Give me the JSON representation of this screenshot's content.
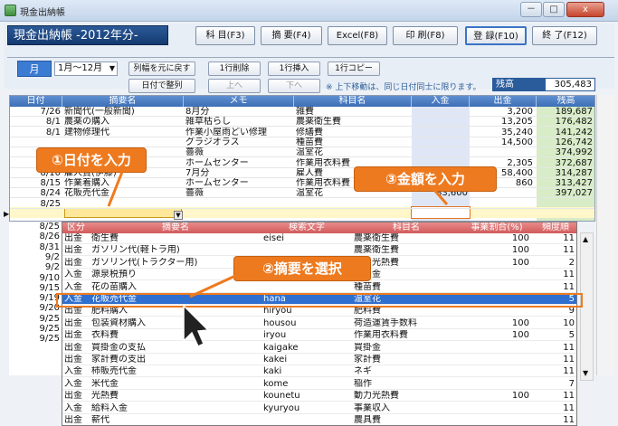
{
  "window": {
    "title": "現金出納帳",
    "min_label": "－",
    "max_label": "□",
    "close_label": "x"
  },
  "app_title": "現金出納帳 -2012年分-",
  "toolbar": [
    {
      "label": "科 目(F3)"
    },
    {
      "label": "摘 要(F4)"
    },
    {
      "label": "Excel(F8)"
    },
    {
      "label": "印 刷(F8)"
    },
    {
      "label": "登 録(F10)"
    },
    {
      "label": "終 了(F12)"
    }
  ],
  "controls": {
    "month_button": "月",
    "month_range": "1月〜12月",
    "reset_width": "列幅を元に戻す",
    "delete_row": "1行削除",
    "insert_row": "1行挿入",
    "copy_row": "1行コピー",
    "sort_date": "日付で整列",
    "up": "上へ",
    "down": "下へ",
    "note": "※ 上下移動は、同じ日付同士に限ります。",
    "balance_label": "残高",
    "balance_value": "305,483"
  },
  "ledger": {
    "headers": [
      "日付",
      "摘要名",
      "メモ",
      "科目名",
      "入金",
      "出金",
      "残高"
    ],
    "rows": [
      {
        "date": "7/26",
        "desc": "新聞代(一般新聞)",
        "memo": "8月分",
        "account": "雑費",
        "in": "",
        "out": "3,200",
        "bal": "189,687"
      },
      {
        "date": "8/1",
        "desc": "農薬の購入",
        "memo": "雑草枯らし",
        "account": "農薬衛生費",
        "in": "",
        "out": "13,205",
        "bal": "176,482"
      },
      {
        "date": "8/1",
        "desc": "建物修理代",
        "memo": "作業小屋雨どい修理",
        "account": "修繕費",
        "in": "",
        "out": "35,240",
        "bal": "141,242"
      },
      {
        "date": "",
        "desc": "",
        "memo": "グラジオラス",
        "account": "種苗費",
        "in": "",
        "out": "14,500",
        "bal": "126,742"
      },
      {
        "date": "",
        "desc": "",
        "memo": "薔薇",
        "account": "温室花",
        "in": "",
        "out": "",
        "bal": "374,992"
      },
      {
        "date": "8/6",
        "desc": "作業着購入",
        "memo": "ホームセンター",
        "account": "作業用衣料費",
        "in": "",
        "out": "2,305",
        "bal": "372,687"
      },
      {
        "date": "8/10",
        "desc": "雇人費(伊藤)",
        "memo": "7月分",
        "account": "雇人費",
        "in": "",
        "out": "58,400",
        "bal": "314,287"
      },
      {
        "date": "8/15",
        "desc": "作業着購入",
        "memo": "ホームセンター",
        "account": "作業用衣料費",
        "in": "",
        "out": "860",
        "bal": "313,427"
      },
      {
        "date": "8/24",
        "desc": "花販売代金",
        "memo": "薔薇",
        "account": "温室花",
        "in": "83,600",
        "out": "",
        "bal": "397,027"
      },
      {
        "date": "8/25",
        "desc": "",
        "memo": "",
        "account": "",
        "in": "",
        "out": "",
        "bal": ""
      }
    ]
  },
  "side_dates": [
    "8/25",
    "8/26",
    "8/31",
    "9/2",
    "9/2",
    "9/10",
    "9/15",
    "9/19",
    "9/20",
    "9/25",
    "9/25",
    "9/25"
  ],
  "callouts": {
    "date": "①日付を入力",
    "amount": "③金額を入力",
    "summary": "②摘要を選択"
  },
  "dropdown": {
    "headers": [
      "区分",
      "摘要名",
      "検索文字",
      "科目名",
      "事業割合(%)",
      "頻度順"
    ],
    "rows": [
      {
        "kind": "出金",
        "name": "衛生費",
        "search": "eisei",
        "account": "農薬衛生費",
        "ratio": "100",
        "freq": "11"
      },
      {
        "kind": "出金",
        "name": "ガソリン代(軽トラ用)",
        "search": "",
        "account": "農薬衛生費",
        "ratio": "100",
        "freq": "11"
      },
      {
        "kind": "出金",
        "name": "ガソリン代(トラクター用)",
        "search": "",
        "account": "動力光熱費",
        "ratio": "100",
        "freq": "2"
      },
      {
        "kind": "入金",
        "name": "源泉税預り",
        "search": "",
        "account": "預り金",
        "ratio": "",
        "freq": "11"
      },
      {
        "kind": "入金",
        "name": "花の苗購入",
        "search": "",
        "account": "種苗費",
        "ratio": "",
        "freq": "11"
      },
      {
        "kind": "入金",
        "name": "花販売代金",
        "search": "hana",
        "account": "温室花",
        "ratio": "",
        "freq": "5"
      },
      {
        "kind": "出金",
        "name": "肥料購入",
        "search": "hiryou",
        "account": "肥料費",
        "ratio": "",
        "freq": "9"
      },
      {
        "kind": "出金",
        "name": "包装資材購入",
        "search": "housou",
        "account": "荷造運賃手数料",
        "ratio": "100",
        "freq": "10"
      },
      {
        "kind": "出金",
        "name": "衣料費",
        "search": "iryou",
        "account": "作業用衣料費",
        "ratio": "100",
        "freq": "5"
      },
      {
        "kind": "出金",
        "name": "買掛金の支払",
        "search": "kaigake",
        "account": "買掛金",
        "ratio": "",
        "freq": "11"
      },
      {
        "kind": "出金",
        "name": "家計費の支出",
        "search": "kakei",
        "account": "家計費",
        "ratio": "",
        "freq": "11"
      },
      {
        "kind": "入金",
        "name": "柿販売代金",
        "search": "kaki",
        "account": "ネギ",
        "ratio": "",
        "freq": "11"
      },
      {
        "kind": "入金",
        "name": "米代金",
        "search": "kome",
        "account": "稲作",
        "ratio": "",
        "freq": "7"
      },
      {
        "kind": "出金",
        "name": "光熱費",
        "search": "kounetu",
        "account": "動力光熱費",
        "ratio": "100",
        "freq": "11"
      },
      {
        "kind": "入金",
        "name": "給料入金",
        "search": "kyuryou",
        "account": "事業収入",
        "ratio": "",
        "freq": "11"
      },
      {
        "kind": "出金",
        "name": "薪代",
        "search": "",
        "account": "農具費",
        "ratio": "",
        "freq": "11"
      }
    ]
  },
  "colors": {
    "accent": "#3d6fb7",
    "callout": "#ee7a1f",
    "highlight": "#2f6fcf",
    "balance_col": "#d7ecc7"
  }
}
